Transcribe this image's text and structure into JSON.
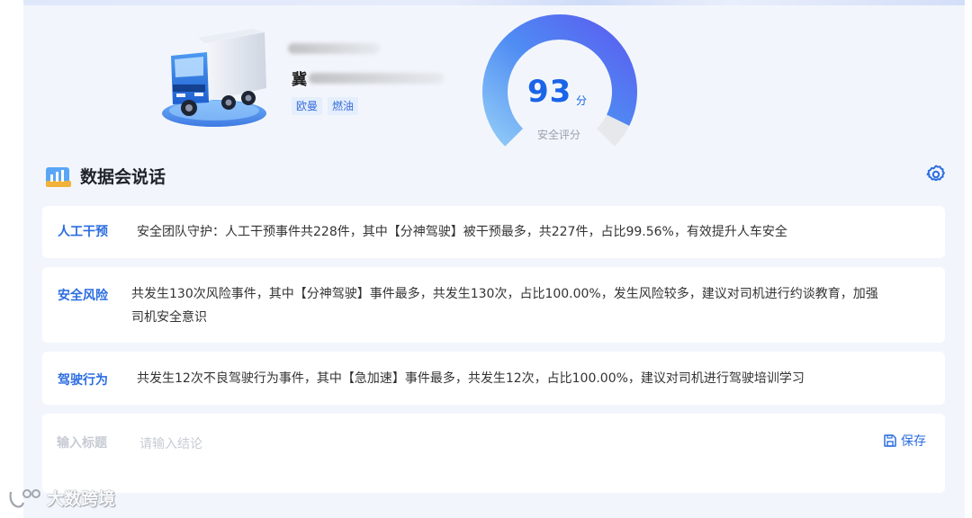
{
  "vehicle": {
    "plate_prefix": "冀",
    "tags": [
      "欧曼",
      "燃油"
    ]
  },
  "score": {
    "value": "93",
    "unit": "分",
    "label": "安全评分",
    "fraction": 0.93
  },
  "section": {
    "title": "数据会说话"
  },
  "cards": [
    {
      "label": "人工干预",
      "text": "安全团队守护：人工干预事件共228件，其中【分神驾驶】被干预最多，共227件，占比99.56%，有效提升人车安全"
    },
    {
      "label": "安全风险",
      "text_line1": "共发生130次风险事件，其中【分神驾驶】事件最多，共发生130次，占比100.00%，发生风险较多，建议对司机进行约谈教育，加强",
      "text_line2": "司机安全意识"
    },
    {
      "label": "驾驶行为",
      "text": "共发生12次不良驾驶行为事件，其中【急加速】事件最多，共发生12次，占比100.00%，建议对司机进行驾驶培训学习"
    }
  ],
  "conclusion": {
    "title_placeholder": "输入标题",
    "body_placeholder": "请输入结论",
    "save_label": "保存"
  },
  "watermark": "大数跨境",
  "colors": {
    "accent": "#2b6de0",
    "gauge_start": "#7ab8f5",
    "gauge_end": "#5a5ff0"
  }
}
